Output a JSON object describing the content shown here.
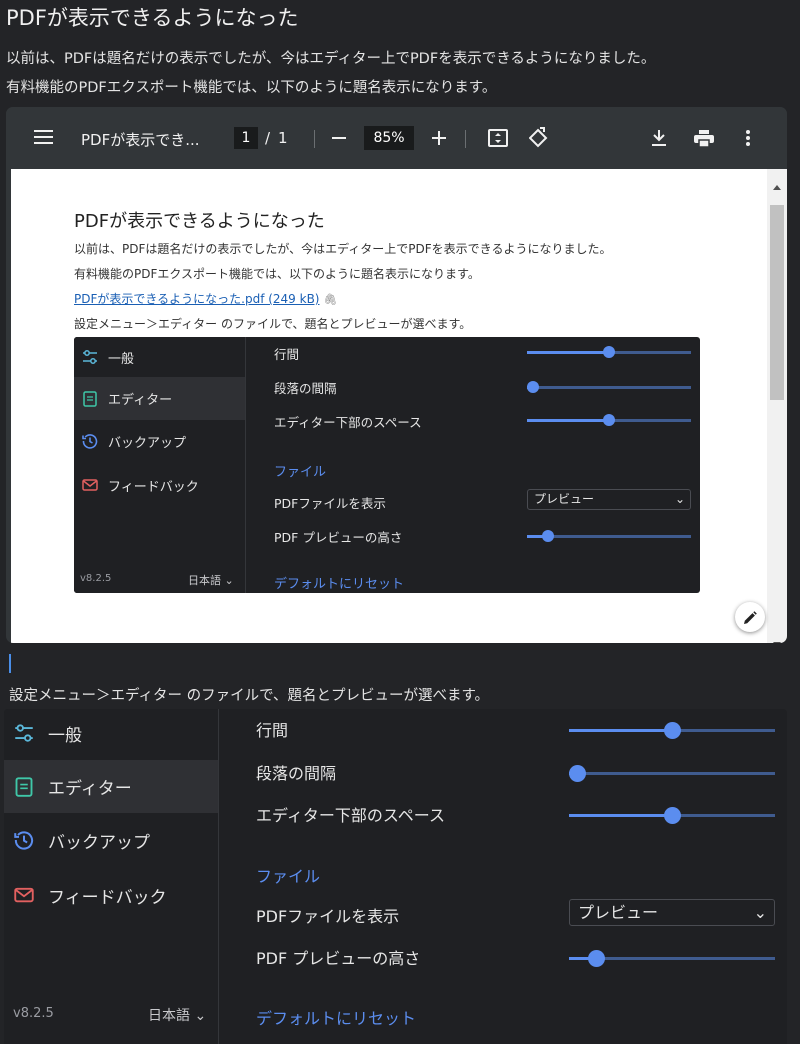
{
  "heading": "PDFが表示できるようになった",
  "intro_1": "以前は、PDFは題名だけの表示でしたが、今はエディター上でPDFを表示できるようになりました。",
  "intro_2": "有料機能のPDFエクスポート機能では、以下のように題名表示になります。",
  "viewer": {
    "title": "PDFが表示でき...",
    "page_current": "1",
    "page_sep": "/",
    "page_total": "1",
    "zoom": "85%",
    "icons": [
      "menu-icon",
      "zoom-out-icon",
      "zoom-in-icon",
      "fit-page-icon",
      "rotate-icon",
      "download-icon",
      "print-icon",
      "more-icon"
    ]
  },
  "pdf_page": {
    "heading": "PDFが表示できるようになった",
    "line_1": "以前は、PDFは題名だけの表示でしたが、今はエディター上でPDFを表示できるようになりました。",
    "line_2": "有料機能のPDFエクスポート機能では、以下のように題名表示になります。",
    "link": "PDFが表示できるようになった.pdf (249 kB)",
    "line_3": "設定メニュー＞エディター のファイルで、題名とプレビューが選べます。"
  },
  "caption": "設定メニュー＞エディター のファイルで、題名とプレビューが選べます。",
  "settings": {
    "sidebar": [
      {
        "label": "一般",
        "icon": "sliders-icon",
        "color": "#5bb7d9"
      },
      {
        "label": "エディター",
        "icon": "document-icon",
        "color": "#3fc7a8",
        "active": true
      },
      {
        "label": "バックアップ",
        "icon": "history-icon",
        "color": "#5b8def"
      },
      {
        "label": "フィードバック",
        "icon": "mail-icon",
        "color": "#e26060"
      }
    ],
    "version": "v8.2.5",
    "language": "日本語",
    "rows": {
      "line_spacing": {
        "label": "行間",
        "value": 0.5
      },
      "paragraph_spacing": {
        "label": "段落の間隔",
        "value": 0.0
      },
      "bottom_space": {
        "label": "エディター下部のスペース",
        "value": 0.5
      }
    },
    "section_file": "ファイル",
    "show_pdf": {
      "label": "PDFファイルを表示",
      "selected": "プレビュー"
    },
    "preview_height": {
      "label": "PDF プレビューの高さ",
      "value": 0.1
    },
    "reset": "デフォルトにリセット"
  },
  "colors": {
    "accent": "#5b8def",
    "background": "#232427",
    "panel": "#1f2023"
  }
}
